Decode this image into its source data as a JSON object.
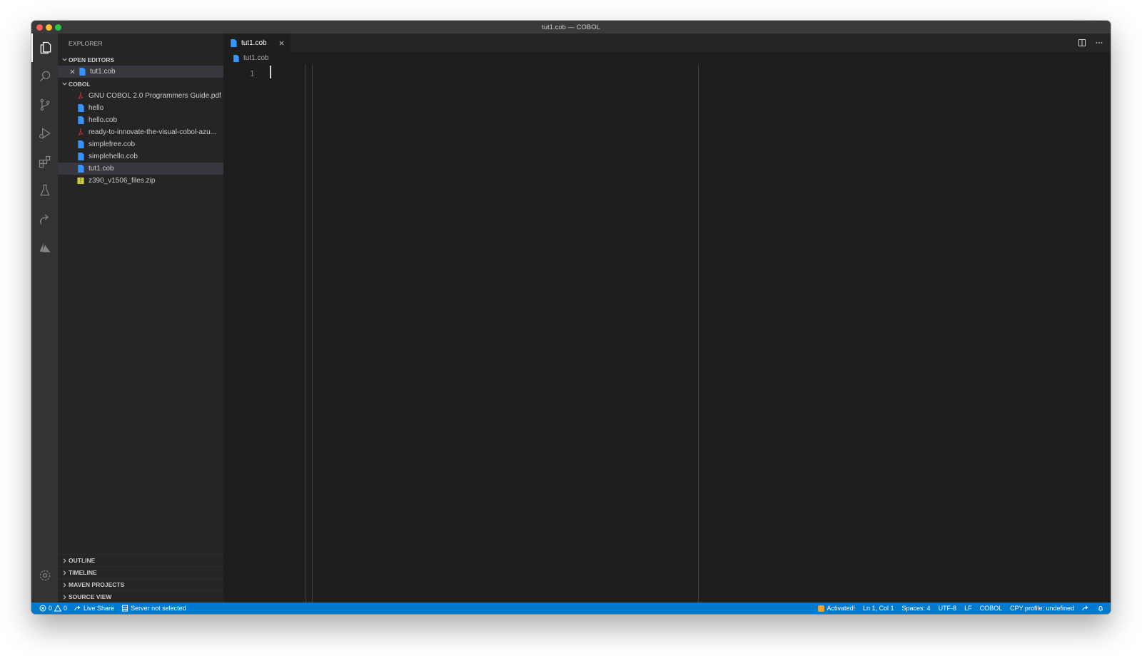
{
  "window": {
    "title": "tut1.cob — COBOL"
  },
  "explorer": {
    "title": "EXPLORER",
    "open_editors_label": "OPEN EDITORS",
    "open_editors": [
      {
        "name": "tut1.cob"
      }
    ],
    "folder_label": "COBOL",
    "files": [
      {
        "name": "GNU COBOL 2.0 Programmers Guide.pdf",
        "icon": "pdf-icon"
      },
      {
        "name": "hello",
        "icon": "file-icon"
      },
      {
        "name": "hello.cob",
        "icon": "file-icon"
      },
      {
        "name": "ready-to-innovate-the-visual-cobol-azu...",
        "icon": "pdf-icon"
      },
      {
        "name": "simplefree.cob",
        "icon": "file-icon"
      },
      {
        "name": "simplehello.cob",
        "icon": "file-icon"
      },
      {
        "name": "tut1.cob",
        "icon": "file-icon",
        "selected": true
      },
      {
        "name": "z390_v1506_files.zip",
        "icon": "zip-icon"
      }
    ],
    "bottom_sections": [
      "OUTLINE",
      "TIMELINE",
      "MAVEN PROJECTS",
      "SOURCE VIEW"
    ]
  },
  "editor": {
    "tab_label": "tut1.cob",
    "breadcrumb": "tut1.cob",
    "line_numbers": [
      "1"
    ]
  },
  "statusbar": {
    "errors": "0",
    "warnings": "0",
    "live_share": "Live Share",
    "server": "Server not selected",
    "activated": "Activated!",
    "position": "Ln 1, Col 1",
    "spaces": "Spaces: 4",
    "encoding": "UTF-8",
    "eol": "LF",
    "language": "COBOL",
    "profile": "CPY profile: undefined"
  },
  "colors": {
    "accent": "#007acc",
    "file_blue": "#3794ff",
    "pdf_red": "#cc3333",
    "zip_yellow": "#cbcb41"
  }
}
